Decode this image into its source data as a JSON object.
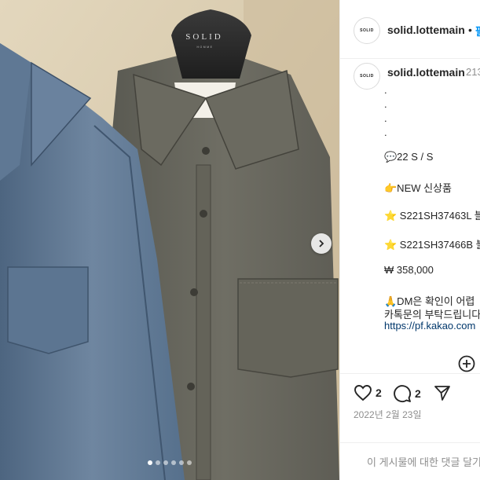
{
  "photo": {
    "tag_brand": "SOLID",
    "tag_sub": "HOMME",
    "carousel_count": 6,
    "carousel_active": 1
  },
  "header": {
    "avatar_text": "SOLID",
    "username": "solid.lottemain",
    "separator": "•",
    "follow_label": "팔"
  },
  "caption": {
    "avatar_text": "SOLID",
    "username": "solid.lottemain",
    "time": "213",
    "lines": [
      ".",
      ".",
      ".",
      ".",
      "💬22 S / S",
      "👉NEW 신상품",
      "⭐ S221SH37463L 블",
      "⭐ S221SH37466B 블",
      "₩ 358,000",
      "🙏DM은 확인이 어렵",
      "카톡문의 부탁드립니다",
      "https://pf.kakao.com"
    ]
  },
  "actions": {
    "likes": "2",
    "comments": "2",
    "date": "2022년 2월 23일"
  },
  "comment": {
    "placeholder": "이 게시물에 대한 댓글 달기..."
  },
  "colors": {
    "link": "#00376b",
    "accent": "#0095f6",
    "muted": "#8e8e8e"
  }
}
